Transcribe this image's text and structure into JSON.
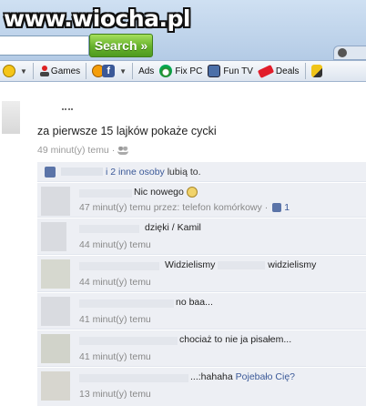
{
  "watermark": "www.wiocha.pl",
  "search": {
    "button_label": "Search »",
    "value": ""
  },
  "toolbar": {
    "items": [
      {
        "label": "Games",
        "icon": "joystick-icon"
      },
      {
        "label": "Ads",
        "icon": ""
      },
      {
        "label": "Fix PC",
        "icon": "fix-pc-icon"
      },
      {
        "label": "Fun TV",
        "icon": "tv-icon"
      },
      {
        "label": "Deals",
        "icon": "deals-tag-icon"
      }
    ]
  },
  "post": {
    "text": "za pierwsze 15 lajków pokaże cycki",
    "time": "49 minut(y) temu",
    "separator": "·",
    "likes": {
      "others_link": "i 2 inne osoby",
      "suffix": "lubią to."
    }
  },
  "comments": [
    {
      "text": "Nic nowego",
      "has_emoji": true,
      "time": "47 minut(y) temu przez: telefon komórkowy",
      "extra": "· ",
      "like_count": "1"
    },
    {
      "text": "dzięki / Kamil",
      "time": "44 minut(y) temu"
    },
    {
      "text_a": "Widzielismy",
      "text_b": "widzielismy",
      "time": "44 minut(y) temu"
    },
    {
      "text": "no baa...",
      "time": "41 minut(y) temu"
    },
    {
      "text": "chociaż to nie ja pisałem...",
      "time": "41 minut(y) temu"
    },
    {
      "text": "...:hahaha",
      "link": "Pojebało Cię?",
      "time": "13 minut(y) temu"
    }
  ]
}
